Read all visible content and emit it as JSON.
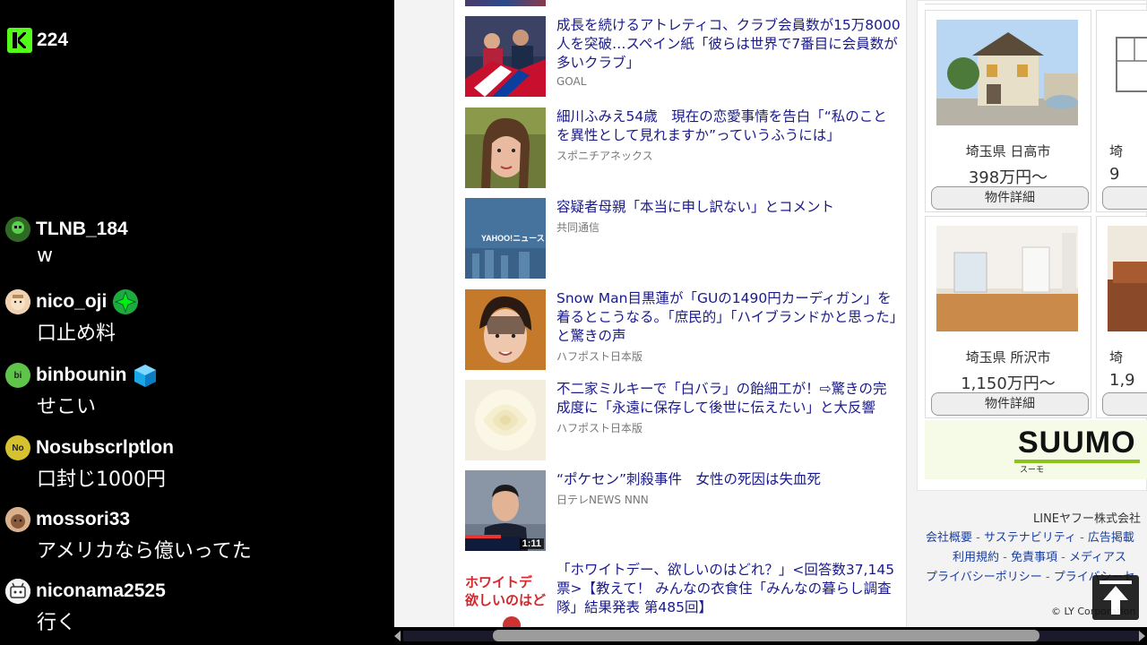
{
  "viewer": {
    "icon": "kick-logo-icon",
    "count": "224"
  },
  "chat": [
    {
      "user": "TLNB_184",
      "avatar_color": "#3a7f2c",
      "avatar_label": "",
      "badge": "",
      "text": "w"
    },
    {
      "user": "nico_oji",
      "avatar_color": "#d9b48f",
      "avatar_label": "",
      "badge": "green-star-badge-icon",
      "text": "口止め料"
    },
    {
      "user": "binbounin",
      "avatar_color": "#5fc44a",
      "avatar_label": "bi",
      "badge": "blue-cube-badge-icon",
      "text": "せこい"
    },
    {
      "user": "Nosubscrlptlon",
      "avatar_color": "#d6c22e",
      "avatar_label": "No",
      "badge": "",
      "text": "口封じ1000円"
    },
    {
      "user": "mossori33",
      "avatar_color": "#c69b7a",
      "avatar_label": "",
      "badge": "",
      "text": "アメリカなら億いってた"
    },
    {
      "user": "niconama2525",
      "avatar_color": "#e8e8e8",
      "avatar_label": "",
      "badge": "",
      "text": "行く"
    }
  ],
  "news": [
    {
      "headline": "成長を続けるアトレティコ、クラブ会員数が15万8000人を突破…スペイン紙「彼らは世界で7番目に会員数が多いクラブ」",
      "source": "GOAL",
      "thumb": "soccer-photo",
      "duration": ""
    },
    {
      "headline": "細川ふみえ54歳　現在の恋愛事情を告白「“私のことを異性として見れますか”っていうふうには」",
      "source": "スポニチアネックス",
      "thumb": "woman-photo",
      "duration": ""
    },
    {
      "headline": "容疑者母親「本当に申し訳ない」とコメント",
      "source": "共同通信",
      "thumb": "yahoo-news-placeholder",
      "thumb_text": "YAHOO!ニュース",
      "duration": ""
    },
    {
      "headline": "Snow Man目黒蓮が「GUの1490円カーディガン」を着るとこうなる。「庶民的」「ハイブランドかと思った」と驚きの声",
      "source": "ハフポスト日本版",
      "thumb": "man-photo",
      "duration": ""
    },
    {
      "headline": "不二家ミルキーで「白バラ」の飴細工が！⇨驚きの完成度に「永遠に保存して後世に伝えたい」と大反響",
      "source": "ハフポスト日本版",
      "thumb": "rose-photo",
      "duration": ""
    },
    {
      "headline": "“ポケセン”刺殺事件　女性の死因は失血死",
      "source": "日テレNEWS NNN",
      "thumb": "news-video-photo",
      "duration": "1:11"
    },
    {
      "headline": "「ホワイトデー、欲しいのはどれ？」<回答数37,145票>【教えて！ みんなの衣食住「みんなの暮らし調査隊」結果発表 第485回】",
      "source": "",
      "thumb": "whiteday-photo",
      "thumb_text": "ホワイトデ 欲しいのはど",
      "duration": ""
    }
  ],
  "ad": {
    "properties": [
      {
        "location": "埼玉県 日高市",
        "price": "398万円〜",
        "button": "物件詳細"
      },
      {
        "location": "埼玉県 所沢市",
        "price": "1,150万円〜",
        "button": "物件詳細"
      },
      {
        "location": "埼",
        "price": "9",
        "button": ""
      },
      {
        "location": "埼",
        "price": "1,9",
        "button": ""
      }
    ],
    "brand": "SUUMO",
    "brand_sub": "スーモ"
  },
  "footer": {
    "corp": "LINEヤフー株式会社",
    "links_row1": [
      "会社概要",
      "サステナビリティ",
      "広告掲載"
    ],
    "links_row2": [
      "利用規約",
      "免責事項",
      "メディアス"
    ],
    "links_row3": [
      "プライバシーポリシー",
      "プライバシーセ"
    ],
    "copyright": "© LY Corporation"
  },
  "to_top_icon": "arrow-up-icon"
}
